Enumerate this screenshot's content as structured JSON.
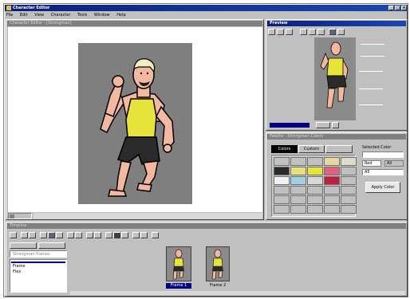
{
  "app": {
    "title": "Character Editor"
  },
  "menu": [
    "File",
    "Edit",
    "View",
    "Character",
    "Tools",
    "Window",
    "Help"
  ],
  "editor": {
    "title": "Character Editor - [Strongman]"
  },
  "preview": {
    "title": "Preview"
  },
  "palette": {
    "title": "Palette - Strongman Colors",
    "tabs": [
      "Colors",
      "Custom"
    ],
    "swatches": [
      "#2a2a2a",
      "#e6e07a",
      "#c0c0c0",
      "#e8d7a0",
      "#dddddd",
      "#9fd2e0",
      "#e06080",
      "#c02040",
      "#d0d0c0"
    ],
    "side_label": "Selected Color",
    "opt1": "Red",
    "opt2": "All",
    "value": "A5",
    "apply": "Apply Color"
  },
  "timeline": {
    "title": "Timeline",
    "search_placeholder": "Strongman frames",
    "list": [
      "Frame",
      "Flex"
    ],
    "frame_labels": [
      "Frame 1",
      "Frame 2"
    ]
  },
  "colors": {
    "title_active": "#0a1f7a",
    "selection": "#000080"
  }
}
